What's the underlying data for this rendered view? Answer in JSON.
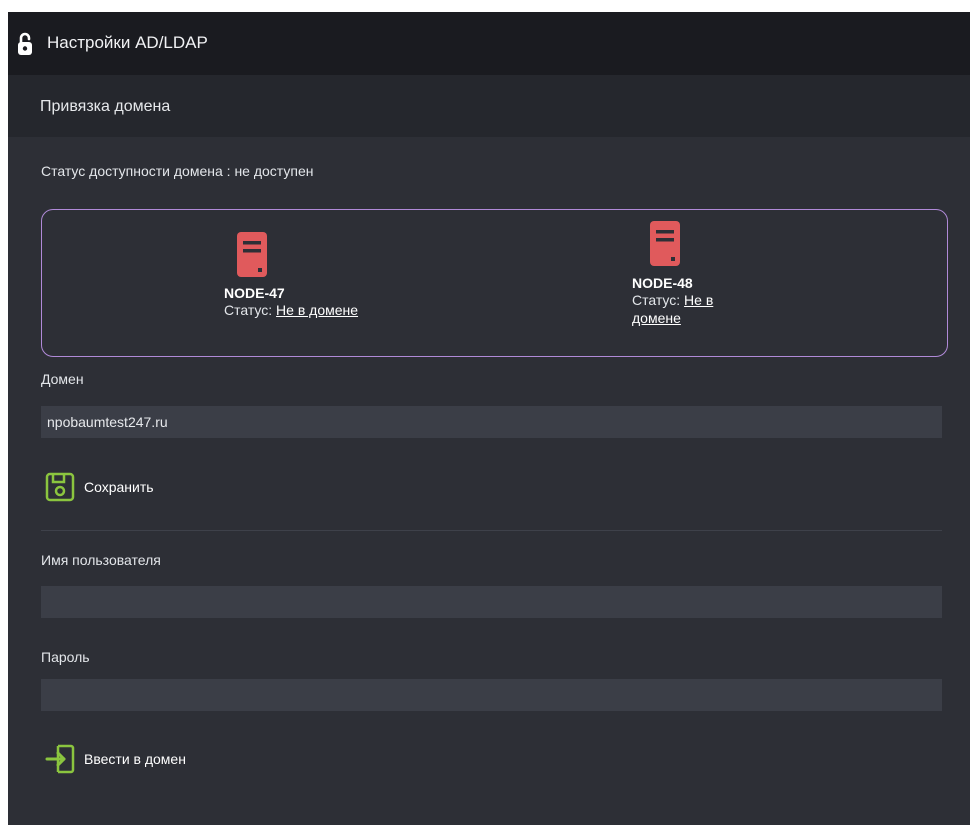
{
  "header": {
    "title": "Настройки AD/LDAP",
    "icon": "unlock-icon"
  },
  "subheader": {
    "title": "Привязка домена"
  },
  "domain_status": {
    "text": "Статус доступности домена : не доступен"
  },
  "nodes": [
    {
      "name": "NODE-47",
      "status_label": "Статус:",
      "status_value": "Не в домене",
      "icon_color": "#e05a5c"
    },
    {
      "name": "NODE-48",
      "status_label": "Статус:",
      "status_value": "Не в домене",
      "icon_color": "#e05a5c"
    }
  ],
  "domain": {
    "label": "Домен",
    "value": "npobaumtest247.ru"
  },
  "save_button": {
    "label": "Сохранить",
    "icon": "save-icon"
  },
  "username": {
    "label": "Имя пользователя",
    "value": ""
  },
  "password": {
    "label": "Пароль",
    "value": ""
  },
  "join_button": {
    "label": "Ввести в домен",
    "icon": "login-icon"
  },
  "colors": {
    "accent_green": "#8bc53f",
    "node_border": "#b08ad8",
    "server_red": "#e05a5c"
  }
}
